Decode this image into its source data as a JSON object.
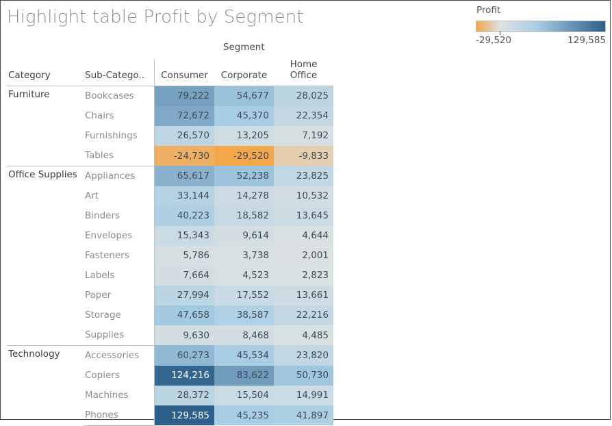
{
  "title": "Highlight table Profit by Segment",
  "legend": {
    "title": "Profit",
    "min_label": "-29,520",
    "max_label": "129,585",
    "min_value": -29520,
    "max_value": 129585,
    "color_low": "#f3a64a",
    "color_mid": "#dde2e2",
    "color_high": "#2c5f8a"
  },
  "table": {
    "column_group_label": "Segment",
    "row_headers": [
      "Category",
      "Sub-Catego.."
    ],
    "columns": [
      "Consumer",
      "Corporate",
      "Home Office"
    ],
    "groups": [
      {
        "category": "Furniture",
        "rows": [
          {
            "sub": "Bookcases",
            "values": [
              "79,222",
              "54,677",
              "28,025"
            ]
          },
          {
            "sub": "Chairs",
            "values": [
              "72,672",
              "45,370",
              "22,354"
            ]
          },
          {
            "sub": "Furnishings",
            "values": [
              "26,570",
              "13,205",
              "7,192"
            ]
          },
          {
            "sub": "Tables",
            "values": [
              "-24,730",
              "-29,520",
              "-9,833"
            ]
          }
        ]
      },
      {
        "category": "Office Supplies",
        "rows": [
          {
            "sub": "Appliances",
            "values": [
              "65,617",
              "52,238",
              "23,825"
            ]
          },
          {
            "sub": "Art",
            "values": [
              "33,144",
              "14,278",
              "10,532"
            ]
          },
          {
            "sub": "Binders",
            "values": [
              "40,223",
              "18,582",
              "13,645"
            ]
          },
          {
            "sub": "Envelopes",
            "values": [
              "15,343",
              "9,614",
              "4,644"
            ]
          },
          {
            "sub": "Fasteners",
            "values": [
              "5,786",
              "3,738",
              "2,001"
            ]
          },
          {
            "sub": "Labels",
            "values": [
              "7,664",
              "4,523",
              "2,823"
            ]
          },
          {
            "sub": "Paper",
            "values": [
              "27,994",
              "17,552",
              "13,661"
            ]
          },
          {
            "sub": "Storage",
            "values": [
              "47,658",
              "38,587",
              "22,216"
            ]
          },
          {
            "sub": "Supplies",
            "values": [
              "9,630",
              "8,468",
              "4,485"
            ]
          }
        ]
      },
      {
        "category": "Technology",
        "rows": [
          {
            "sub": "Accessories",
            "values": [
              "60,273",
              "45,534",
              "23,820"
            ]
          },
          {
            "sub": "Copiers",
            "values": [
              "124,216",
              "83,622",
              "50,730"
            ]
          },
          {
            "sub": "Machines",
            "values": [
              "28,372",
              "15,504",
              "14,991"
            ]
          },
          {
            "sub": "Phones",
            "values": [
              "129,585",
              "45,235",
              "41,897"
            ]
          }
        ]
      }
    ]
  },
  "chart_data": {
    "type": "heatmap",
    "title": "Highlight table Profit by Segment",
    "xlabel": "Segment",
    "ylabel": "Category / Sub-Category",
    "measure": "Profit",
    "categories_x": [
      "Consumer",
      "Corporate",
      "Home Office"
    ],
    "categories_y": [
      "Furniture / Bookcases",
      "Furniture / Chairs",
      "Furniture / Furnishings",
      "Furniture / Tables",
      "Office Supplies / Appliances",
      "Office Supplies / Art",
      "Office Supplies / Binders",
      "Office Supplies / Envelopes",
      "Office Supplies / Fasteners",
      "Office Supplies / Labels",
      "Office Supplies / Paper",
      "Office Supplies / Storage",
      "Office Supplies / Supplies",
      "Technology / Accessories",
      "Technology / Copiers",
      "Technology / Machines",
      "Technology / Phones"
    ],
    "values": [
      [
        79222,
        54677,
        28025
      ],
      [
        72672,
        45370,
        22354
      ],
      [
        26570,
        13205,
        7192
      ],
      [
        -24730,
        -29520,
        -9833
      ],
      [
        65617,
        52238,
        23825
      ],
      [
        33144,
        14278,
        10532
      ],
      [
        40223,
        18582,
        13645
      ],
      [
        15343,
        9614,
        4644
      ],
      [
        5786,
        3738,
        2001
      ],
      [
        7664,
        4523,
        2823
      ],
      [
        27994,
        17552,
        13661
      ],
      [
        47658,
        38587,
        22216
      ],
      [
        9630,
        8468,
        4485
      ],
      [
        60273,
        45534,
        23820
      ],
      [
        124216,
        83622,
        50730
      ],
      [
        28372,
        15504,
        14991
      ],
      [
        129585,
        45235,
        41897
      ]
    ],
    "color_scale": {
      "min": -29520,
      "max": 129585,
      "low": "#f3a64a",
      "mid": "#dde2e2",
      "high": "#2c5f8a"
    },
    "grid": false,
    "legend_position": "top-right"
  }
}
